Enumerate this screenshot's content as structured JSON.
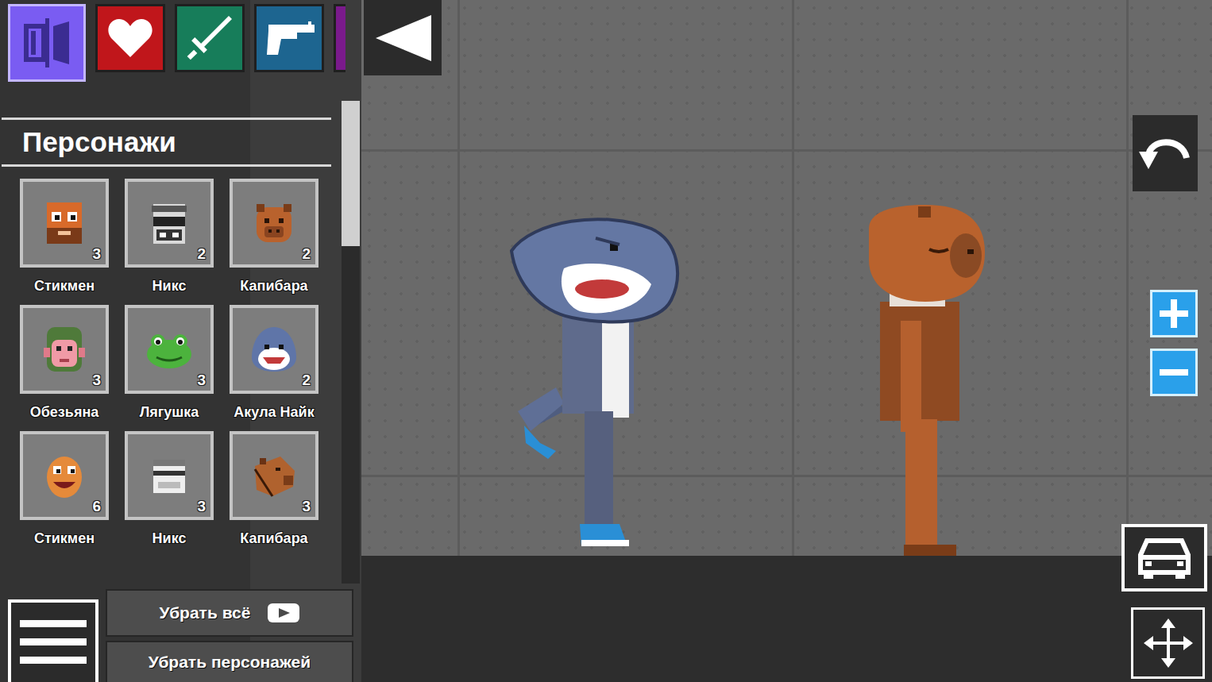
{
  "categories": [
    {
      "kind": "ragdoll",
      "color": "#7a5cf2",
      "selected": true
    },
    {
      "kind": "health",
      "color": "#c0161b",
      "selected": false
    },
    {
      "kind": "melee",
      "color": "#177d5a",
      "selected": false
    },
    {
      "kind": "firearm",
      "color": "#1d6590",
      "selected": false
    },
    {
      "kind": "explosive",
      "color": "#7a1a8c",
      "selected": false
    }
  ],
  "section": {
    "title": "Персонажи"
  },
  "characters": [
    {
      "name": "Стикмен",
      "count": "3",
      "kind": "stickman"
    },
    {
      "name": "Никс",
      "count": "2",
      "kind": "nix"
    },
    {
      "name": "Капибара",
      "count": "2",
      "kind": "capybara"
    },
    {
      "name": "Обезьяна",
      "count": "3",
      "kind": "monkey"
    },
    {
      "name": "Лягушка",
      "count": "3",
      "kind": "frog"
    },
    {
      "name": "Акула Найк",
      "count": "2",
      "kind": "shark"
    },
    {
      "name": "Стикмен",
      "count": "6",
      "kind": "stickman-alt"
    },
    {
      "name": "Никс",
      "count": "3",
      "kind": "nix-alt"
    },
    {
      "name": "Капибара",
      "count": "3",
      "kind": "capybara-side"
    }
  ],
  "actions": [
    {
      "label": "Убрать всё",
      "kind": "video"
    },
    {
      "label": "Убрать персонажей",
      "kind": "plain"
    }
  ],
  "scene": {
    "figures": [
      {
        "kind": "shark"
      },
      {
        "kind": "capybara"
      }
    ]
  }
}
